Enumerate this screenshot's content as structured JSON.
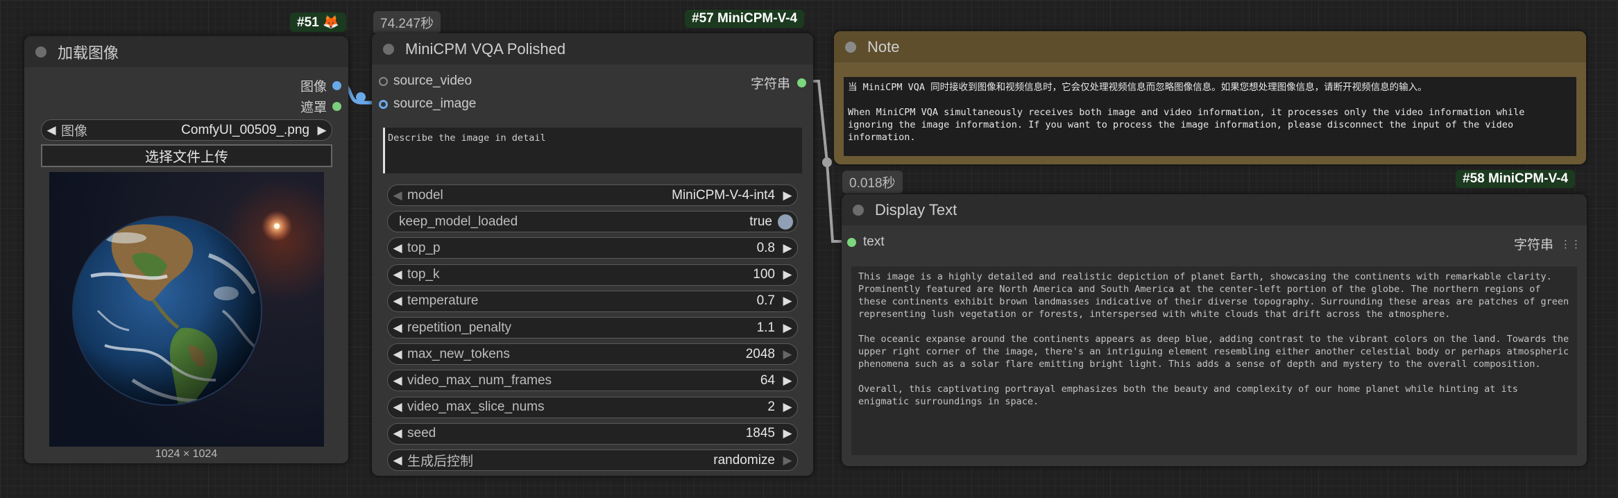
{
  "colors": {
    "image_slot": "#6aa9e8",
    "mask_slot": "#7ccf7c",
    "string_slot": "#7cd67c",
    "link_image": "#6aa9e8",
    "link_string": "#a0a0a0",
    "note_header": "#5e4e2c",
    "note_body": "#6b5a34",
    "badge_bg": "#1b3a1f"
  },
  "load_image_node": {
    "badge": "#51 🦊",
    "title": "加载图像",
    "outputs": {
      "image": "图像",
      "mask": "遮罩"
    },
    "image_widget": {
      "label": "图像",
      "value": "ComfyUI_00509_.png"
    },
    "upload_label": "选择文件上传",
    "preview_size": "1024 × 1024",
    "preview_icon": "earth-render-image"
  },
  "vqa_node": {
    "time": "74.247秒",
    "badge": "#57 MiniCPM-V-4",
    "title": "MiniCPM VQA Polished",
    "inputs": {
      "video": "source_video",
      "image": "source_image"
    },
    "output": "字符串",
    "prompt": "Describe the image in detail",
    "widgets": [
      {
        "label": "model",
        "value": "MiniCPM-V-4-int4",
        "type": "combo"
      },
      {
        "label": "keep_model_loaded",
        "value": "true",
        "type": "toggle"
      },
      {
        "label": "top_p",
        "value": "0.8",
        "type": "number"
      },
      {
        "label": "top_k",
        "value": "100",
        "type": "number"
      },
      {
        "label": "temperature",
        "value": "0.7",
        "type": "number"
      },
      {
        "label": "repetition_penalty",
        "value": "1.1",
        "type": "number"
      },
      {
        "label": "max_new_tokens",
        "value": "2048",
        "type": "number"
      },
      {
        "label": "video_max_num_frames",
        "value": "64",
        "type": "number"
      },
      {
        "label": "video_max_slice_nums",
        "value": "2",
        "type": "number"
      },
      {
        "label": "seed",
        "value": "1845",
        "type": "number"
      },
      {
        "label": "生成后控制",
        "value": "randomize",
        "type": "combo"
      }
    ]
  },
  "note_node": {
    "title": "Note",
    "text": "当 MiniCPM VQA 同时接收到图像和视频信息时，它会仅处理视频信息而忽略图像信息。如果您想处理图像信息，请断开视频信息的输入。\n\nWhen MiniCPM VQA simultaneously receives both image and video information, it processes only the video information while ignoring the image information. If you want to process the image information, please disconnect the input of the video information."
  },
  "display_node": {
    "time": "0.018秒",
    "badge": "#58 MiniCPM-V-4",
    "title": "Display Text",
    "input": "text",
    "output": "字符串",
    "text": "This image is a highly detailed and realistic depiction of planet Earth, showcasing the continents with remarkable clarity. Prominently featured are North America and South America at the center-left portion of the globe. The northern regions of these continents exhibit brown landmasses indicative of their diverse topography. Surrounding these areas are patches of green representing lush vegetation or forests, interspersed with white clouds that drift across the atmosphere.\n\nThe oceanic expanse around the continents appears as deep blue, adding contrast to the vibrant colors on the land. Towards the upper right corner of the image, there's an intriguing element resembling either another celestial body or perhaps atmospheric phenomena such as a solar flare emitting bright light. This adds a sense of depth and mystery to the overall composition.\n\nOverall, this captivating portrayal emphasizes both the beauty and complexity of our home planet while hinting at its enigmatic surroundings in space."
  }
}
